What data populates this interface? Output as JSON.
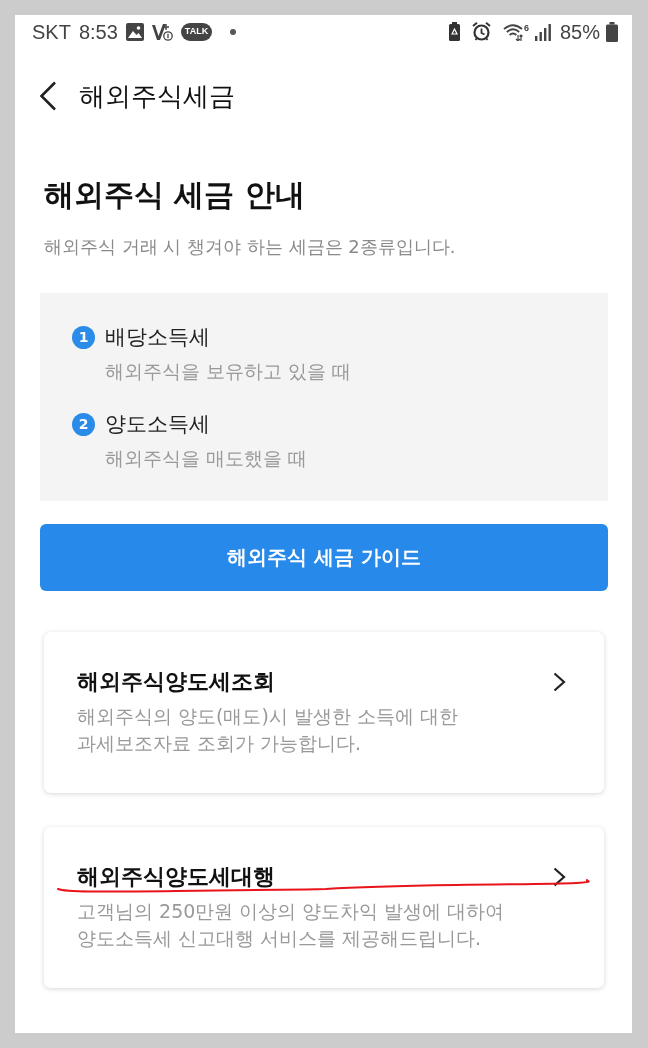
{
  "status_bar": {
    "carrier": "SKT",
    "time": "8:53",
    "chat_badge": "TALK",
    "wifi_band": "6",
    "battery": "85%"
  },
  "header": {
    "title": "해외주식세금"
  },
  "intro": {
    "title": "해외주식 세금 안내",
    "subtitle": "해외주식 거래 시 챙겨야 하는 세금은 2종류입니다."
  },
  "tax_types": [
    {
      "number": "1",
      "name": "배당소득세",
      "description": "해외주식을 보유하고 있을 때"
    },
    {
      "number": "2",
      "name": "양도소득세",
      "description": "해외주식을 매도했을 때"
    }
  ],
  "guide_button": "해외주식 세금 가이드",
  "menu_cards": [
    {
      "title": "해외주식양도세조회",
      "description": [
        "해외주식의 양도(매도)시 발생한 소득에 대한",
        "과세보조자료 조회가 가능합니다."
      ],
      "underlined": false
    },
    {
      "title": "해외주식양도세대행",
      "description": [
        "고객님의 250만원 이상의 양도차익 발생에 대하여",
        "양도소득세 신고대행 서비스를 제공해드립니다."
      ],
      "underlined": true
    }
  ]
}
